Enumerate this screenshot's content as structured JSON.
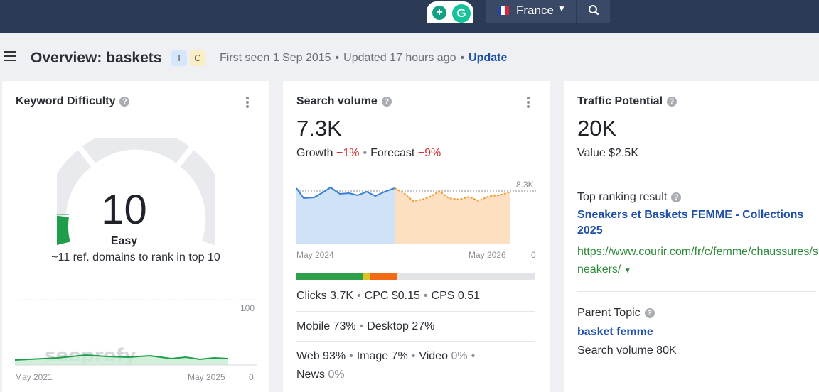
{
  "topbar": {
    "country": "France",
    "extensions": [
      "extension-a-icon",
      "grammarly-icon"
    ]
  },
  "header": {
    "title": "Overview: baskets",
    "badges": [
      "I",
      "C"
    ],
    "first_seen": "First seen 1 Sep 2015",
    "updated": "Updated 17 hours ago",
    "update_link": "Update"
  },
  "keyword_difficulty": {
    "title": "Keyword Difficulty",
    "value": "10",
    "label": "Easy",
    "description": "~11 ref. domains to rank in top 10",
    "chart": {
      "y_max_label": "100",
      "y_min_label": "0",
      "x_start": "May 2021",
      "x_end": "May 2025",
      "watermark": "seoprofy"
    }
  },
  "search_volume": {
    "title": "Search volume",
    "value": "7.3K",
    "growth_label": "Growth",
    "growth": "−1%",
    "forecast_label": "Forecast",
    "forecast": "−9%",
    "chart": {
      "y_max_label": "8.3K",
      "y_min_label": "0",
      "x_start": "May 2024",
      "x_end": "May 2026"
    },
    "clicks": "Clicks 3.7K",
    "cpc": "CPC $0.15",
    "cps": "CPS 0.51",
    "mobile": "Mobile 73%",
    "desktop": "Desktop 27%",
    "web": "Web 93%",
    "image": "Image 7%",
    "video_label": "Video",
    "video_value": "0%",
    "news_label": "News",
    "news_value": "0%"
  },
  "traffic_potential": {
    "title": "Traffic Potential",
    "value": "20K",
    "value_line": "Value $2.5K",
    "top_result_label": "Top ranking result",
    "top_result_title": "Sneakers et Baskets FEMME - Collections 2025",
    "top_result_url": "https://www.courir.com/fr/c/femme/chaussures/sneakers/",
    "parent_topic_label": "Parent Topic",
    "parent_topic": "basket femme",
    "parent_volume": "Search volume 80K"
  },
  "colors": {
    "topbar": "#2b3a55",
    "link": "#1d4fa8",
    "negative": "#d32f2f",
    "gauge_easy": "#1e9e4a",
    "chart_actual": "#3a7fd5",
    "chart_forecast": "#f29a2e"
  }
}
